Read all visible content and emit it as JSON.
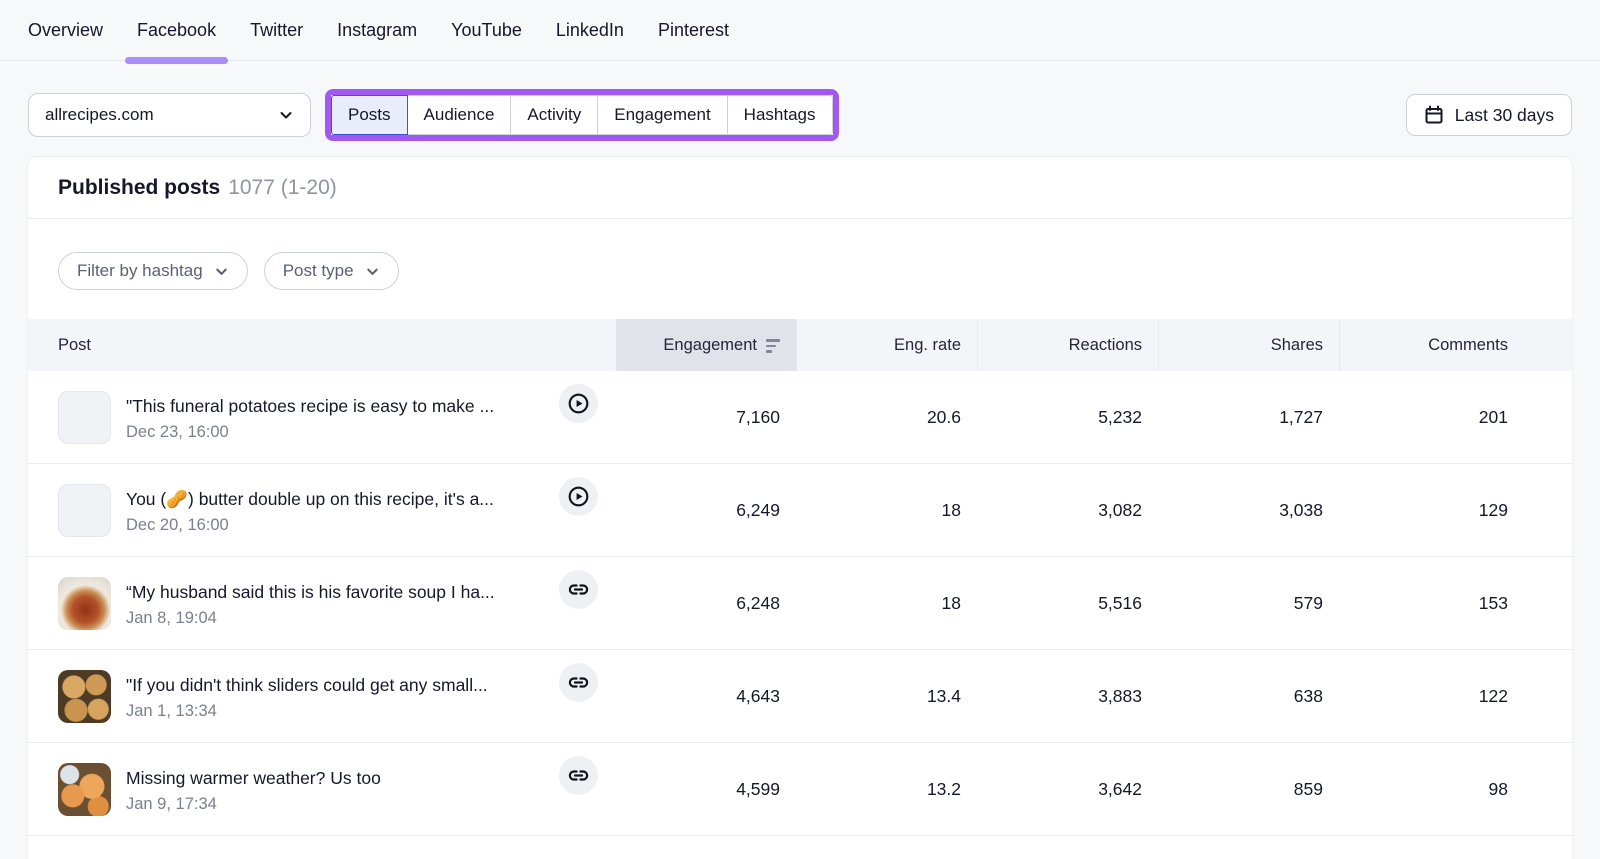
{
  "nav": {
    "tabs": [
      {
        "label": "Overview",
        "active": false
      },
      {
        "label": "Facebook",
        "active": true
      },
      {
        "label": "Twitter",
        "active": false
      },
      {
        "label": "Instagram",
        "active": false
      },
      {
        "label": "YouTube",
        "active": false
      },
      {
        "label": "LinkedIn",
        "active": false
      },
      {
        "label": "Pinterest",
        "active": false
      }
    ]
  },
  "toolbar": {
    "profile_select": {
      "value": "allrecipes.com",
      "icon": "chevron-down-icon"
    },
    "section_tabs": {
      "items": [
        "Posts",
        "Audience",
        "Activity",
        "Engagement",
        "Hashtags"
      ],
      "selected": "Posts",
      "annotation_color": "#a259f0"
    },
    "date_range": {
      "label": "Last 30 days",
      "icon": "calendar-icon"
    }
  },
  "panel": {
    "title": "Published posts",
    "count": "1077 (1-20)",
    "filters": [
      {
        "label": "Filter by hashtag",
        "icon": "chevron-down-icon"
      },
      {
        "label": "Post type",
        "icon": "chevron-down-icon"
      }
    ]
  },
  "table": {
    "columns": [
      "Post",
      "Engagement",
      "Eng. rate",
      "Reactions",
      "Shares",
      "Comments"
    ],
    "sorted_by": "Engagement",
    "sort_icon": "sort-desc-icon",
    "rows": [
      {
        "title": "\"This funeral potatoes recipe is easy to make ...",
        "date": "Dec 23, 16:00",
        "media_icon": "play-icon",
        "thumbnail": "empty-placeholder",
        "engagement": "7,160",
        "eng_rate": "20.6",
        "reactions": "5,232",
        "shares": "1,727",
        "comments": "201"
      },
      {
        "title": "You (🥜) butter double up on this recipe, it's a...",
        "date": "Dec 20, 16:00",
        "media_icon": "play-icon",
        "thumbnail": "empty-placeholder",
        "engagement": "6,249",
        "eng_rate": "18",
        "reactions": "3,082",
        "shares": "3,038",
        "comments": "129"
      },
      {
        "title": "“My husband said this is his favorite soup I ha...",
        "date": "Jan 8, 19:04",
        "media_icon": "link-icon",
        "thumbnail": "soup-photo",
        "engagement": "6,248",
        "eng_rate": "18",
        "reactions": "5,516",
        "shares": "579",
        "comments": "153"
      },
      {
        "title": "\"If you didn't think sliders could get any small...",
        "date": "Jan 1, 13:34",
        "media_icon": "link-icon",
        "thumbnail": "sliders-photo",
        "engagement": "4,643",
        "eng_rate": "13.4",
        "reactions": "3,883",
        "shares": "638",
        "comments": "122"
      },
      {
        "title": "Missing warmer weather? Us too",
        "date": "Jan 9, 17:34",
        "media_icon": "link-icon",
        "thumbnail": "peach-desserts-photo",
        "engagement": "4,599",
        "eng_rate": "13.2",
        "reactions": "3,642",
        "shares": "859",
        "comments": "98"
      }
    ]
  },
  "colors": {
    "annotation_purple": "#a259f0",
    "active_tab_underline": "#a98ef6",
    "selected_segment_border": "#3c50d8",
    "selected_segment_bg": "#e9edfb",
    "header_row_bg": "#f4f5f8",
    "sorted_header_bg": "#e2e3ea",
    "page_bg": "#f7f8fa"
  }
}
